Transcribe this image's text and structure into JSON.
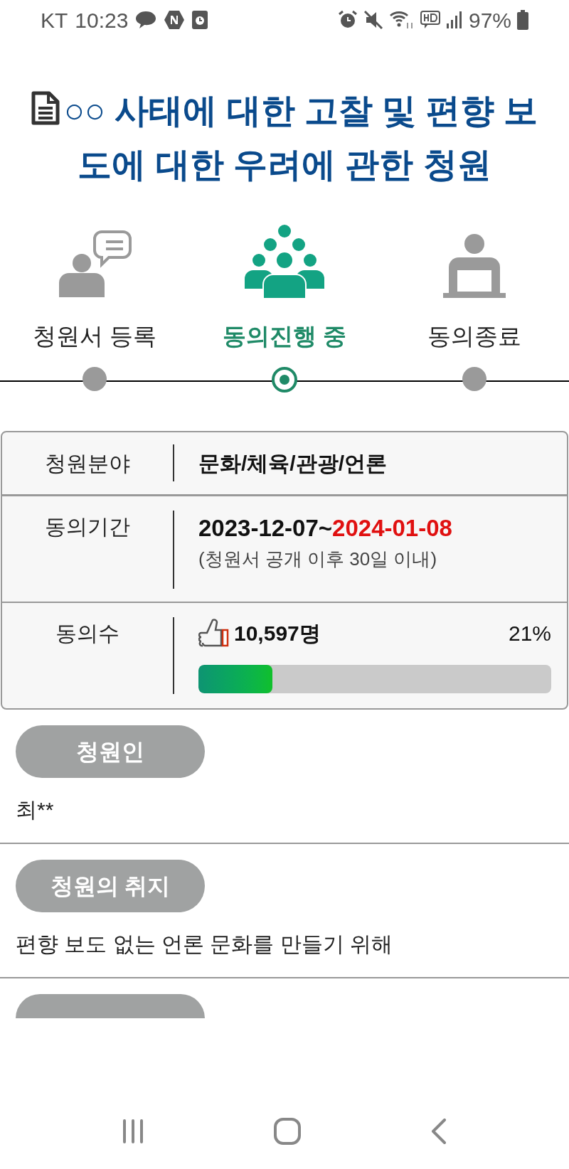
{
  "status_bar": {
    "carrier": "KT",
    "time": "10:23",
    "battery": "97%"
  },
  "title": "○○ 사태에 대한 고찰 및 편향 보도에 대한 우려에 관한 청원",
  "steps": [
    {
      "kind": "speaker",
      "label": "청원서 등록",
      "selected": false
    },
    {
      "kind": "crowd",
      "label": "동의진행 중",
      "selected": true
    },
    {
      "kind": "podium",
      "label": "동의종료",
      "selected": false
    }
  ],
  "info": {
    "field_label": "청원분야",
    "field_value": "문화/체육/관광/언론",
    "period_label": "동의기간",
    "period_start": "2023-12-07~",
    "period_end": "2024-01-08",
    "period_note": "(청원서 공개 이후 30일 이내)",
    "count_label": "동의수",
    "count": "10,597명",
    "percent": "21%",
    "level": 0.21
  },
  "sections": [
    {
      "heading": "청원인",
      "body": "최**"
    },
    {
      "heading": "청원의 취지",
      "body": "편향 보도 없는 언론 문화를 만들기 위해"
    }
  ]
}
